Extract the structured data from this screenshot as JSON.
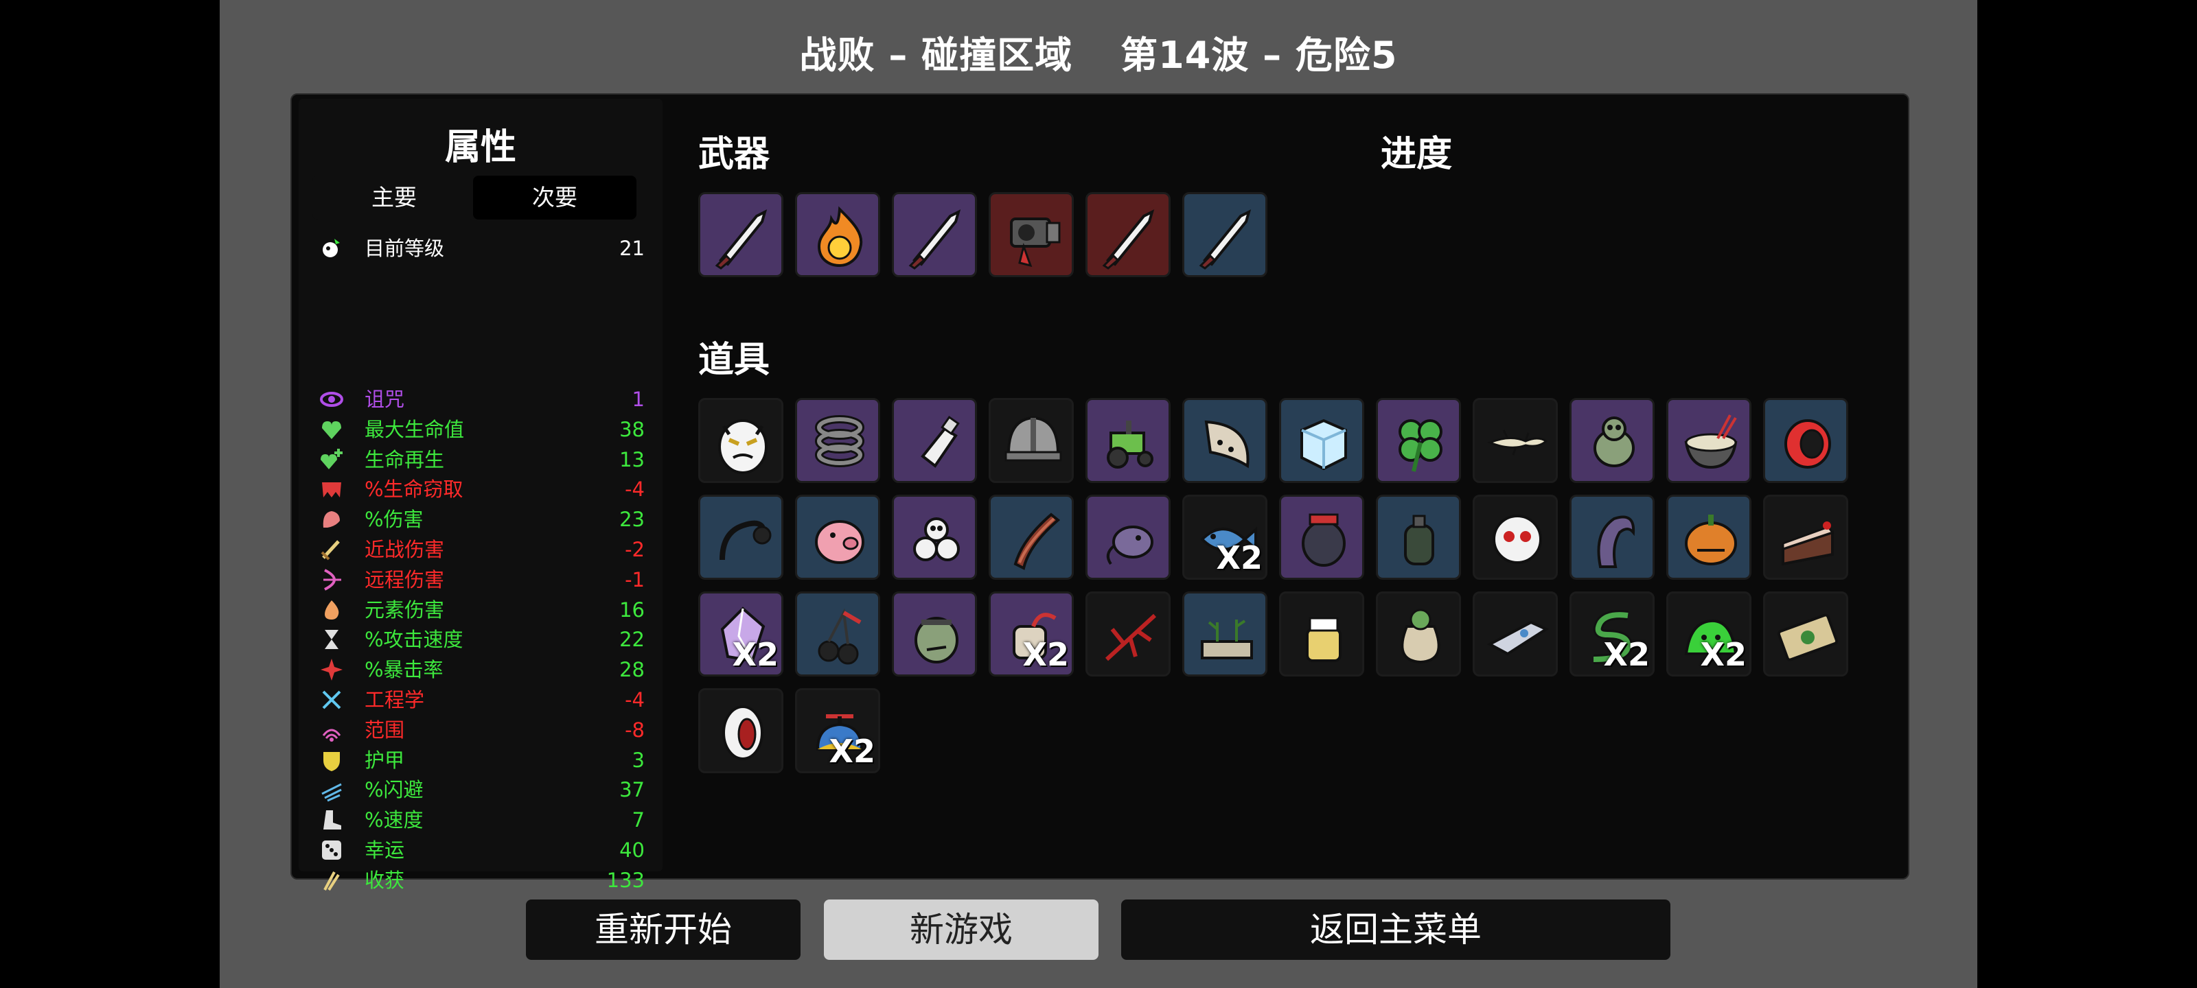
{
  "header": {
    "result": "战败 – 碰撞区域",
    "wave": "第14波 – 危险5"
  },
  "stats_panel": {
    "title": "属性",
    "tabs": [
      {
        "label": "主要",
        "active": false
      },
      {
        "label": "次要",
        "active": true
      }
    ],
    "level": {
      "label": "目前等级",
      "value": "21",
      "color": "#ffffff"
    },
    "rows": [
      {
        "icon": "eye-icon",
        "label": "诅咒",
        "value": "1",
        "color": "#b04ee8"
      },
      {
        "icon": "heart-icon",
        "label": "最大生命值",
        "value": "38",
        "color": "#3de83d"
      },
      {
        "icon": "heart-plus-icon",
        "label": "生命再生",
        "value": "13",
        "color": "#3de83d"
      },
      {
        "icon": "fangs-icon",
        "label": "%生命窃取",
        "value": "-4",
        "color": "#ff2a2a"
      },
      {
        "icon": "muscle-icon",
        "label": "%伤害",
        "value": "23",
        "color": "#3de83d"
      },
      {
        "icon": "sword-icon",
        "label": "近战伤害",
        "value": "-2",
        "color": "#ff2a2a"
      },
      {
        "icon": "bow-icon",
        "label": "远程伤害",
        "value": "-1",
        "color": "#ff2a2a"
      },
      {
        "icon": "flame-icon",
        "label": "元素伤害",
        "value": "16",
        "color": "#3de83d"
      },
      {
        "icon": "hourglass-icon",
        "label": "%攻击速度",
        "value": "22",
        "color": "#3de83d"
      },
      {
        "icon": "crit-icon",
        "label": "%暴击率",
        "value": "28",
        "color": "#3de83d"
      },
      {
        "icon": "wrench-icon",
        "label": "工程学",
        "value": "-4",
        "color": "#ff2a2a"
      },
      {
        "icon": "range-icon",
        "label": "范围",
        "value": "-8",
        "color": "#ff2a2a"
      },
      {
        "icon": "shield-icon",
        "label": "护甲",
        "value": "3",
        "color": "#3de83d"
      },
      {
        "icon": "dodge-icon",
        "label": "%闪避",
        "value": "37",
        "color": "#3de83d"
      },
      {
        "icon": "boot-icon",
        "label": "%速度",
        "value": "7",
        "color": "#3de83d"
      },
      {
        "icon": "dice-icon",
        "label": "幸运",
        "value": "40",
        "color": "#3de83d"
      },
      {
        "icon": "harvest-icon",
        "label": "收获",
        "value": "133",
        "color": "#3de83d"
      }
    ]
  },
  "weapons": {
    "title": "武器",
    "items": [
      {
        "icon": "knife-icon",
        "tier": "purple"
      },
      {
        "icon": "fireball-icon",
        "tier": "purple"
      },
      {
        "icon": "knife-icon",
        "tier": "purple"
      },
      {
        "icon": "flamethrower-icon",
        "tier": "red"
      },
      {
        "icon": "knife-icon",
        "tier": "red"
      },
      {
        "icon": "knife-icon",
        "tier": "blue"
      }
    ]
  },
  "progress": {
    "title": "进度"
  },
  "items": {
    "title": "道具",
    "list": [
      {
        "icon": "angry-egg-icon",
        "tier": "dark",
        "count": ""
      },
      {
        "icon": "spring-icon",
        "tier": "purple",
        "count": ""
      },
      {
        "icon": "bottle-icon",
        "tier": "purple",
        "count": ""
      },
      {
        "icon": "helmet-icon",
        "tier": "dark",
        "count": ""
      },
      {
        "icon": "tractor-icon",
        "tier": "purple",
        "count": ""
      },
      {
        "icon": "claw-icon",
        "tier": "blue",
        "count": ""
      },
      {
        "icon": "ice-cube-icon",
        "tier": "blue",
        "count": ""
      },
      {
        "icon": "clover-icon",
        "tier": "purple",
        "count": ""
      },
      {
        "icon": "lizard-icon",
        "tier": "dark",
        "count": ""
      },
      {
        "icon": "alien-bug-icon",
        "tier": "purple",
        "count": ""
      },
      {
        "icon": "noodle-bowl-icon",
        "tier": "purple",
        "count": ""
      },
      {
        "icon": "red-ring-icon",
        "tier": "blue",
        "count": ""
      },
      {
        "icon": "cable-icon",
        "tier": "blue",
        "count": ""
      },
      {
        "icon": "piggy-bank-icon",
        "tier": "blue",
        "count": ""
      },
      {
        "icon": "skull-pile-icon",
        "tier": "purple",
        "count": ""
      },
      {
        "icon": "bacon-icon",
        "tier": "blue",
        "count": ""
      },
      {
        "icon": "mouse-toy-icon",
        "tier": "purple",
        "count": ""
      },
      {
        "icon": "fish-icon",
        "tier": "dark",
        "count": "X2"
      },
      {
        "icon": "jar-icon",
        "tier": "purple",
        "count": ""
      },
      {
        "icon": "grenade-icon",
        "tier": "blue",
        "count": ""
      },
      {
        "icon": "ghost-face-icon",
        "tier": "dark",
        "count": ""
      },
      {
        "icon": "tentacle-icon",
        "tier": "blue",
        "count": ""
      },
      {
        "icon": "pumpkin-icon",
        "tier": "blue",
        "count": ""
      },
      {
        "icon": "cake-slice-icon",
        "tier": "dark",
        "count": ""
      },
      {
        "icon": "crystal-icon",
        "tier": "purple",
        "count": "X2"
      },
      {
        "icon": "cherries-icon",
        "tier": "blue",
        "count": ""
      },
      {
        "icon": "zombie-head-icon",
        "tier": "purple",
        "count": ""
      },
      {
        "icon": "cast-arm-icon",
        "tier": "purple",
        "count": "X2"
      },
      {
        "icon": "red-twig-icon",
        "tier": "dark",
        "count": ""
      },
      {
        "icon": "plant-tray-icon",
        "tier": "blue",
        "count": ""
      },
      {
        "icon": "honey-jar-icon",
        "tier": "dark",
        "count": ""
      },
      {
        "icon": "money-sack-icon",
        "tier": "dark",
        "count": ""
      },
      {
        "icon": "spaceship-icon",
        "tier": "dark",
        "count": ""
      },
      {
        "icon": "snake-icon",
        "tier": "dark",
        "count": "X2"
      },
      {
        "icon": "slime-icon",
        "tier": "dark",
        "count": "X2"
      },
      {
        "icon": "banknote-icon",
        "tier": "dark",
        "count": ""
      },
      {
        "icon": "mouth-icon",
        "tier": "dark",
        "count": ""
      },
      {
        "icon": "propeller-hat-icon",
        "tier": "dark",
        "count": "X2"
      }
    ]
  },
  "buttons": [
    {
      "label": "重新开始",
      "selected": false
    },
    {
      "label": "新游戏",
      "selected": true
    },
    {
      "label": "返回主菜单",
      "selected": false
    }
  ]
}
